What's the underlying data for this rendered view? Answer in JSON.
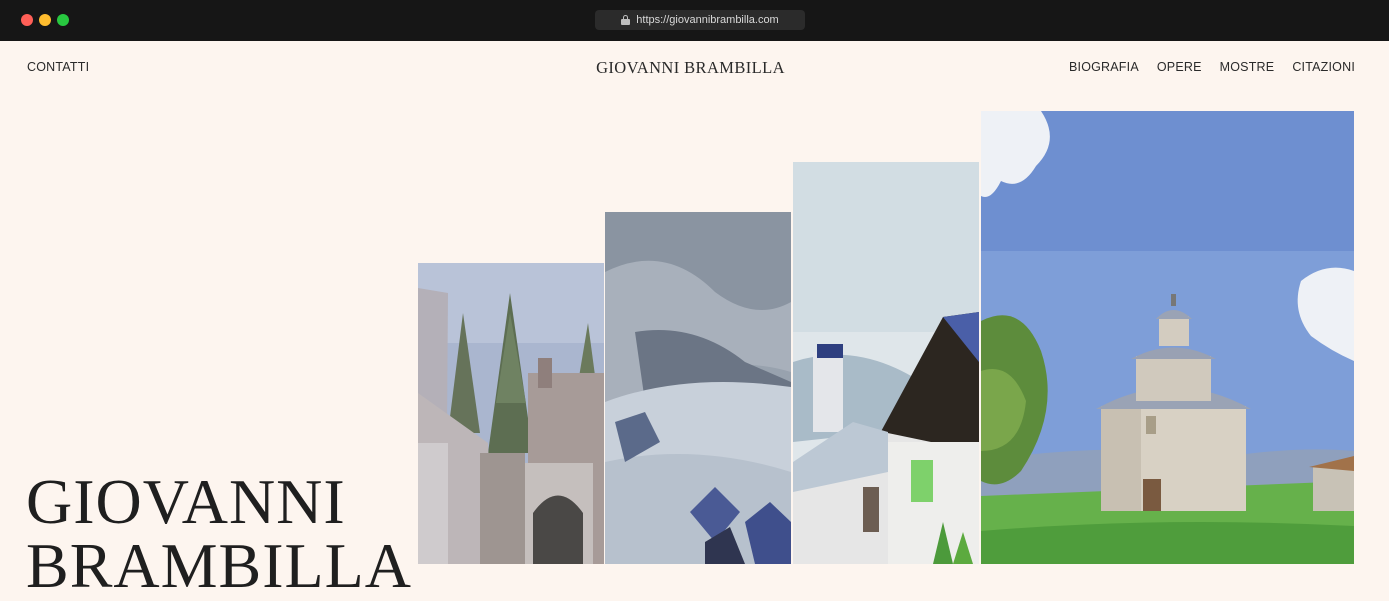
{
  "browser": {
    "url": "https://giovannibrambilla.com",
    "dot_colors": [
      "#ff5f57",
      "#febc2e",
      "#28c840"
    ]
  },
  "header": {
    "left_link": "CONTATTI",
    "logo": "GIOVANNI BRAMBILLA",
    "nav": [
      "BIOGRAFIA",
      "OPERE",
      "MOSTRE",
      "CITAZIONI"
    ]
  },
  "hero": {
    "title_line1": "GIOVANNI",
    "title_line2": "BRAMBILLA"
  },
  "gallery": {
    "paintings": [
      {
        "subject": "castle ruins with pine trees"
      },
      {
        "subject": "snowy mountain with rooftops"
      },
      {
        "subject": "white house with dark roof"
      },
      {
        "subject": "rotunda church in green field"
      }
    ]
  },
  "colors": {
    "background": "#fdf5ef",
    "text": "#2a2a2a"
  }
}
